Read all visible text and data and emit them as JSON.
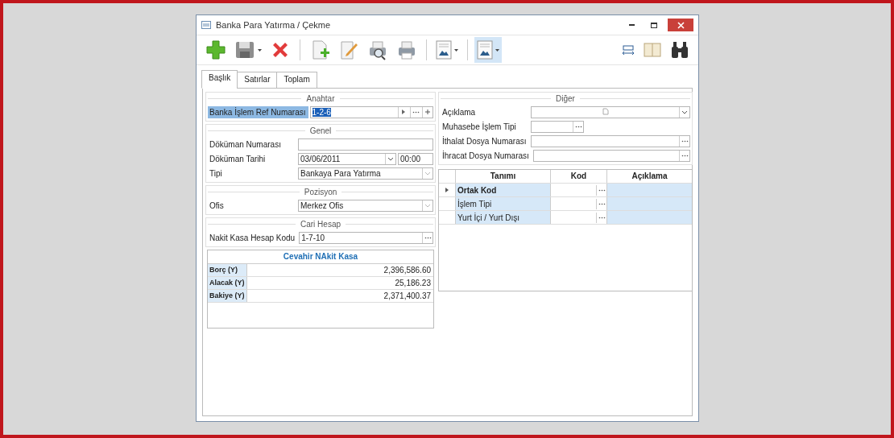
{
  "window": {
    "title": "Banka Para Yatırma / Çekme"
  },
  "toolbar": [
    {
      "kind": "add",
      "active": false
    },
    {
      "kind": "save",
      "active": false
    },
    {
      "kind": "delete",
      "active": false
    },
    {
      "kind": "new-doc",
      "active": false
    },
    {
      "kind": "edit-doc",
      "active": false
    },
    {
      "kind": "preview",
      "active": false
    },
    {
      "kind": "print",
      "active": false
    },
    {
      "kind": "report",
      "active": false
    },
    {
      "kind": "report",
      "active": true
    },
    {
      "kind": "fit",
      "active": false
    },
    {
      "kind": "book",
      "active": false
    },
    {
      "kind": "binoculars",
      "active": false
    }
  ],
  "tabs": [
    {
      "label": "Başlık",
      "selected": true
    },
    {
      "label": "Satırlar",
      "selected": false
    },
    {
      "label": "Toplam",
      "selected": false
    }
  ],
  "left_sections": [
    {
      "title": "Anahtar",
      "fields": [
        {
          "kind": "key",
          "label": "Banka İşlem Ref Numarası",
          "value": "1-2-6"
        }
      ]
    },
    {
      "title": "Genel",
      "fields": [
        {
          "kind": "text",
          "label": "Döküman Numarası"
        },
        {
          "kind": "date",
          "label": "Döküman Tarihi",
          "value": "03/06/2011",
          "time": "00:00"
        },
        {
          "kind": "combo",
          "label": "Tipi",
          "value": "Bankaya Para Yatırma"
        }
      ]
    },
    {
      "title": "Pozisyon",
      "fields": [
        {
          "kind": "combo",
          "label": "Ofis",
          "value": "Merkez Ofis"
        }
      ]
    },
    {
      "title": "Cari Hesap",
      "fields": [
        {
          "kind": "lookup",
          "label": "Nakit Kasa Hesap Kodu",
          "value": "1-7-10"
        }
      ]
    }
  ],
  "balance_card": {
    "title": "Cevahir NAkit Kasa",
    "rows": [
      {
        "label": "Borç (Y)",
        "value": "2,396,586.60"
      },
      {
        "label": "Alacak (Y)",
        "value": "25,186.23"
      },
      {
        "label": "Bakiye (Y)",
        "value": "2,371,400.37"
      }
    ]
  },
  "right_section": {
    "title": "Diğer",
    "fields": [
      {
        "kind": "memo",
        "label": "Açıklama"
      },
      {
        "kind": "short-lookup",
        "label": "Muhasebe İşlem Tipi"
      },
      {
        "kind": "lookup",
        "label": "İthalat Dosya Numarası"
      },
      {
        "kind": "lookup",
        "label": "İhracat Dosya Numarası"
      }
    ]
  },
  "grid": {
    "columns": [
      "Tanımı",
      "Kod",
      "Açıklama"
    ],
    "rows": [
      {
        "name": "Ortak Kod",
        "current": true
      },
      {
        "name": "İşlem Tipi",
        "current": false
      },
      {
        "name": "Yurt İçi / Yurt Dışı",
        "current": false
      }
    ]
  }
}
